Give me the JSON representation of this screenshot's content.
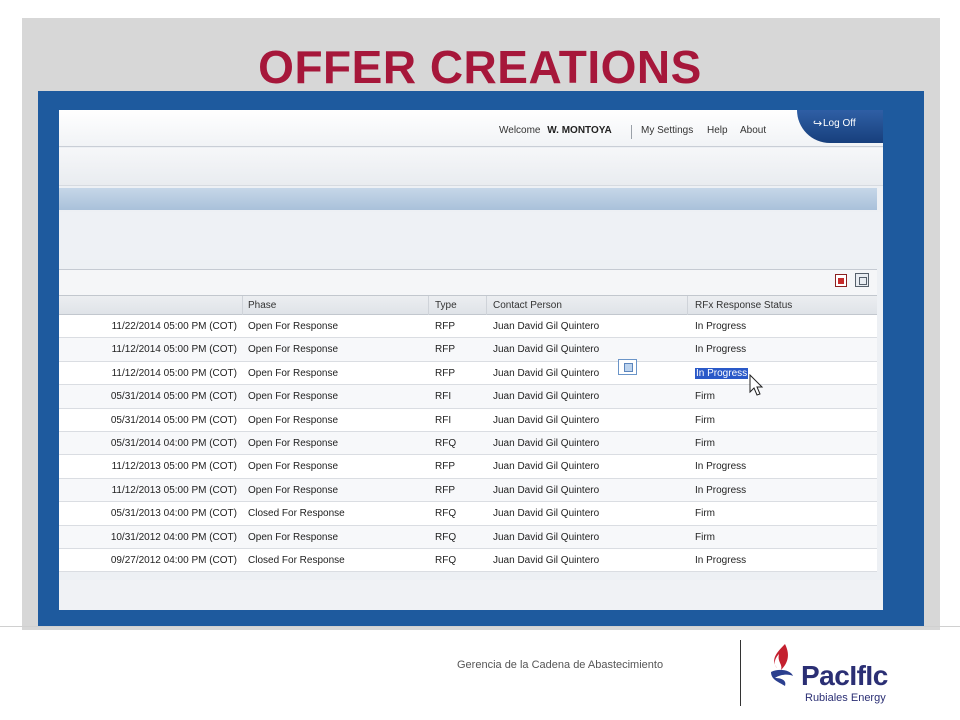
{
  "slide": {
    "title": "OFFER CREATIONS",
    "footer_text": "Gerencia de la Cadena de Abastecimiento",
    "logo_name": "PacIfIc",
    "logo_subtitle": "Rubiales Energy",
    "title_color": "#a6173a"
  },
  "app": {
    "welcome_label": "Welcome",
    "user_name": "W. MONTOYA",
    "nav_links": [
      "My Settings",
      "Help",
      "About"
    ],
    "logoff_label": "Log Off",
    "accent_color": "#1e5a9e"
  },
  "table": {
    "columns": [
      "Phase",
      "Type",
      "Contact Person",
      "RFx Response Status"
    ],
    "rows": [
      {
        "date": "11/22/2014 05:00 PM (COT)",
        "phase": "Open For Response",
        "type": "RFP",
        "contact": "Juan David Gil Quintero",
        "status": "In Progress"
      },
      {
        "date": "11/12/2014 05:00 PM (COT)",
        "phase": "Open For Response",
        "type": "RFP",
        "contact": "Juan David Gil Quintero",
        "status": "In Progress"
      },
      {
        "date": "11/12/2014 05:00 PM (COT)",
        "phase": "Open For Response",
        "type": "RFP",
        "contact": "Juan David Gil Quintero",
        "status": "In Progress"
      },
      {
        "date": "05/31/2014 05:00 PM (COT)",
        "phase": "Open For Response",
        "type": "RFI",
        "contact": "Juan David Gil Quintero",
        "status": "Firm"
      },
      {
        "date": "05/31/2014 05:00 PM (COT)",
        "phase": "Open For Response",
        "type": "RFI",
        "contact": "Juan David Gil Quintero",
        "status": "Firm"
      },
      {
        "date": "05/31/2014 04:00 PM (COT)",
        "phase": "Open For Response",
        "type": "RFQ",
        "contact": "Juan David Gil Quintero",
        "status": "Firm"
      },
      {
        "date": "11/12/2013 05:00 PM (COT)",
        "phase": "Open For Response",
        "type": "RFP",
        "contact": "Juan David Gil Quintero",
        "status": "In Progress"
      },
      {
        "date": "11/12/2013 05:00 PM (COT)",
        "phase": "Open For Response",
        "type": "RFP",
        "contact": "Juan David Gil Quintero",
        "status": "In Progress"
      },
      {
        "date": "05/31/2013 04:00 PM (COT)",
        "phase": "Closed For Response",
        "type": "RFQ",
        "contact": "Juan David Gil Quintero",
        "status": "Firm"
      },
      {
        "date": "10/31/2012 04:00 PM (COT)",
        "phase": "Open For Response",
        "type": "RFQ",
        "contact": "Juan David Gil Quintero",
        "status": "Firm"
      },
      {
        "date": "09/27/2012 04:00 PM (COT)",
        "phase": "Closed For Response",
        "type": "RFQ",
        "contact": "Juan David Gil Quintero",
        "status": "In Progress"
      }
    ],
    "selected_row": 3
  },
  "icons": [
    "pdf-export-icon",
    "excel-export-icon",
    "popup-window-icon",
    "mouse-cursor-icon",
    "logoff-icon"
  ]
}
